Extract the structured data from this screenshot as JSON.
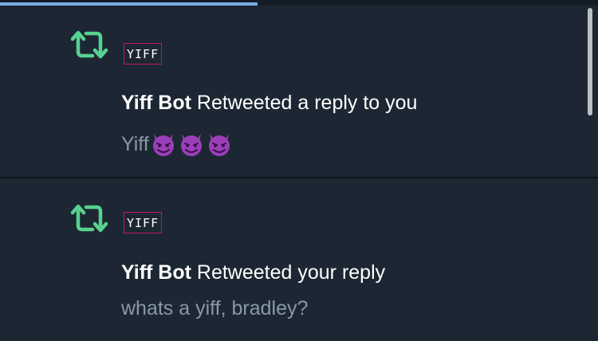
{
  "loading_progress": 0.43,
  "notifications": [
    {
      "badge": "YIFF",
      "user": "Yiff Bot",
      "action": "Retweeted a reply to you",
      "text": "Yiff",
      "emoji_icons": [
        "smiling-imp-icon",
        "smiling-imp-icon",
        "smiling-imp-icon"
      ]
    },
    {
      "badge": "YIFF",
      "user": "Yiff Bot",
      "action": "Retweeted your reply",
      "text": "whats a yiff, bradley?"
    }
  ],
  "colors": {
    "background": "#1c2733",
    "retweet_green": "#57d18f",
    "badge_border": "#c2185b",
    "secondary_text": "#8899a6",
    "progress": "#7aaee6"
  }
}
